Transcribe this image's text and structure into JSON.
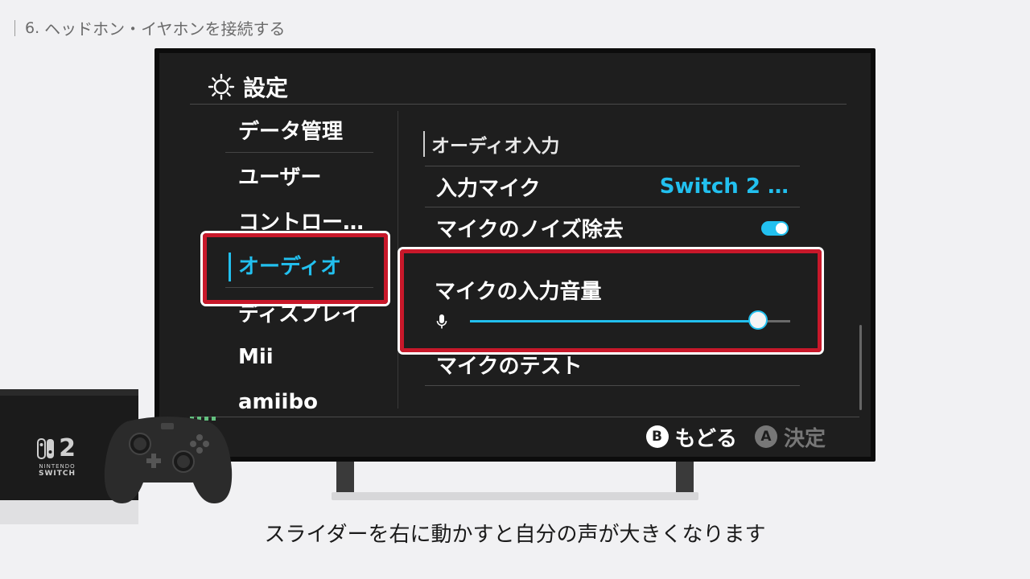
{
  "step": {
    "number": "6.",
    "title": "ヘッドホン・イヤホンを接続する"
  },
  "settings": {
    "title": "設定",
    "sidebar": [
      {
        "label": "データ管理"
      },
      {
        "label": "ユーザー"
      },
      {
        "label": "コントロー…"
      },
      {
        "label": "オーディオ",
        "active": true
      },
      {
        "label": "ディスプレイ"
      },
      {
        "label": "Mii"
      },
      {
        "label": "amiibo"
      }
    ],
    "section_title": "オーディオ入力",
    "rows": {
      "input_mic": {
        "label": "入力マイク",
        "value": "Switch 2 …"
      },
      "noise": {
        "label": "マイクのノイズ除去",
        "toggle_on": true
      },
      "volume": {
        "label": "マイクの入力音量",
        "level": 0.9
      },
      "test": {
        "label": "マイクのテスト"
      }
    },
    "footer": {
      "back_button": "B",
      "back_label": "もどる",
      "ok_button": "A",
      "ok_label": "決定"
    }
  },
  "console": {
    "logo": "2",
    "brand_line1": "NINTENDO",
    "brand_line2": "SWITCH"
  },
  "caption": "スライダーを右に動かすと自分の声が大きくなります",
  "colors": {
    "accent": "#22c0ef",
    "highlight": "#c8182a",
    "screen_bg": "#1e1e1e"
  }
}
